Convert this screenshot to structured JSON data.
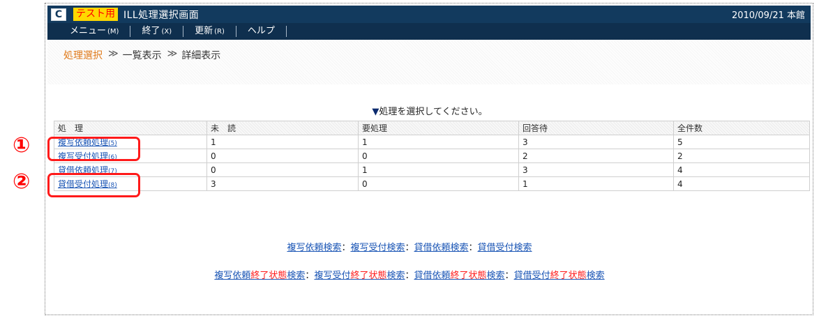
{
  "window": {
    "logo": "C",
    "test_badge": "テスト用",
    "title": "ILL処理選択画面",
    "date_location": "2010/09/21 本館"
  },
  "menu": [
    {
      "label": "メニュー",
      "key": "(M)"
    },
    {
      "label": "終了",
      "key": "(X)"
    },
    {
      "label": "更新",
      "key": "(R)"
    },
    {
      "label": "ヘルプ",
      "key": ""
    }
  ],
  "breadcrumb": {
    "current": "処理選択",
    "sep": "≫",
    "items": [
      "一覧表示",
      "詳細表示"
    ]
  },
  "instruction": {
    "marker": "▼",
    "text": "処理を選択してください。"
  },
  "table": {
    "headers": [
      "処　理",
      "未　読",
      "要処理",
      "回答待",
      "全件数"
    ],
    "rows": [
      {
        "name": "複写依頼処理",
        "count": "(5)",
        "unread": "1",
        "pending": "1",
        "waiting": "3",
        "total": "5"
      },
      {
        "name": "複写受付処理",
        "count": "(6)",
        "unread": "0",
        "pending": "0",
        "waiting": "2",
        "total": "2"
      },
      {
        "name": "貸借依頼処理",
        "count": "(7)",
        "unread": "0",
        "pending": "1",
        "waiting": "3",
        "total": "4"
      },
      {
        "name": "貸借受付処理",
        "count": "(8)",
        "unread": "3",
        "pending": "0",
        "waiting": "1",
        "total": "4"
      }
    ]
  },
  "callouts": [
    "①",
    "②"
  ],
  "search_links": {
    "sep": "：",
    "row1": [
      "複写依頼検索",
      "複写受付検索",
      "貸借依頼検索",
      "貸借受付検索"
    ],
    "row2": [
      {
        "pre": "複写依頼",
        "red": "終了状態",
        "post": "検索"
      },
      {
        "pre": "複写受付",
        "red": "終了状態",
        "post": "検索"
      },
      {
        "pre": "貸借依頼",
        "red": "終了状態",
        "post": "検索"
      },
      {
        "pre": "貸借受付",
        "red": "終了状態",
        "post": "検索"
      }
    ]
  },
  "colors": {
    "titlebar": "#123a5e",
    "menubar": "#0f2f4e",
    "accent_orange": "#e07a1a",
    "link_blue": "#1a55b5",
    "callout_red": "#ff1a1a",
    "badge_yellow": "#ffd800"
  }
}
